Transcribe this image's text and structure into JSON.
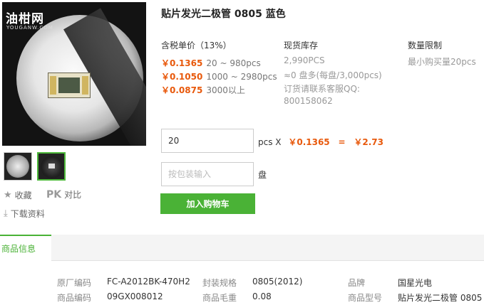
{
  "logo": {
    "main": "油柑网",
    "sub": "YOUGANW.COM"
  },
  "sidebar": {
    "favorite_label": "收藏",
    "pk_label": "PK",
    "compare_label": "对比",
    "download_label": "下载资料"
  },
  "product": {
    "title": "贴片发光二极管 0805 蓝色"
  },
  "pricing": {
    "header": "含税单价（13%）",
    "tiers": [
      {
        "price": "￥0.1365",
        "range": "20 ~ 980pcs"
      },
      {
        "price": "￥0.1050",
        "range": "1000 ~ 2980pcs"
      },
      {
        "price": "￥0.0875",
        "range": "3000以上"
      }
    ]
  },
  "stock": {
    "header": "现货库存",
    "qty": "2,990PCS",
    "reels": "≈0 盘多(每盘/3,000pcs)",
    "contact_line1": "订货请联系客服QQ:",
    "contact_line2": "800158062"
  },
  "limit": {
    "header": "数量限制",
    "text": "最小购买量20pcs"
  },
  "order": {
    "qty_value": "20",
    "unit_label": "pcs X",
    "unit_price": "￥0.1365",
    "equals": "=",
    "total": "￥2.73",
    "pack_placeholder": "按包装输入",
    "pack_unit": "盘",
    "cart_label": "加入购物车"
  },
  "tabs": {
    "info_label": "商品信息"
  },
  "info": {
    "rows": [
      [
        {
          "key": "原厂编码",
          "value": "FC-A2012BK-470H2"
        },
        {
          "key": "封装规格",
          "value": "0805(2012)"
        },
        {
          "key": "品牌",
          "value": "国星光电"
        }
      ],
      [
        {
          "key": "商品编码",
          "value": "09GX008012"
        },
        {
          "key": "商品毛重",
          "value": "0.08"
        },
        {
          "key": "商品型号",
          "value": "贴片发光二极管 0805 ."
        }
      ]
    ]
  },
  "colors": {
    "accent": "#4ab236",
    "price": "#e8590c"
  }
}
